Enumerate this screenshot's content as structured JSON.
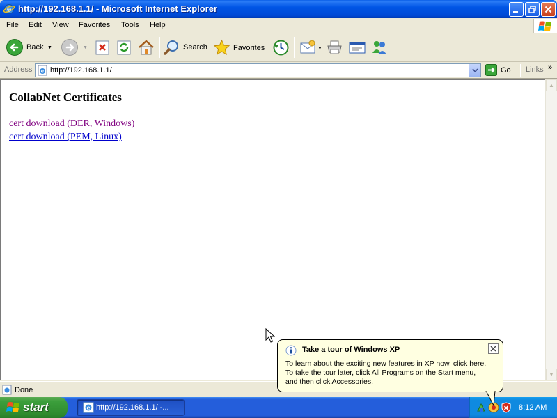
{
  "window": {
    "title": "http://192.168.1.1/ - Microsoft Internet Explorer"
  },
  "menu": {
    "items": [
      "File",
      "Edit",
      "View",
      "Favorites",
      "Tools",
      "Help"
    ]
  },
  "toolbar": {
    "back_label": "Back",
    "search_label": "Search",
    "favorites_label": "Favorites"
  },
  "address_bar": {
    "label": "Address",
    "value": "http://192.168.1.1/",
    "go_label": "Go",
    "links_label": "Links"
  },
  "page": {
    "heading": "CollabNet Certificates",
    "links": [
      {
        "text": "cert download (DER, Windows)",
        "visited": true
      },
      {
        "text": "cert download (PEM, Linux)",
        "visited": false
      }
    ]
  },
  "status_bar": {
    "text": "Done"
  },
  "taskbar": {
    "start_label": "start",
    "task_button_label": "http://192.168.1.1/ -...",
    "clock": "8:12 AM"
  },
  "balloon": {
    "title": "Take a tour of Windows XP",
    "lines": [
      "To learn about the exciting new features in XP now, click here.",
      "To take the tour later, click All Programs on the Start menu,",
      "and then click Accessories."
    ]
  },
  "colors": {
    "title_bar": "#0055e5",
    "visited_link": "#800080",
    "unvisited_link": "#0000cc",
    "start_button": "#3c9f3c",
    "balloon_background": "#ffffe1"
  }
}
